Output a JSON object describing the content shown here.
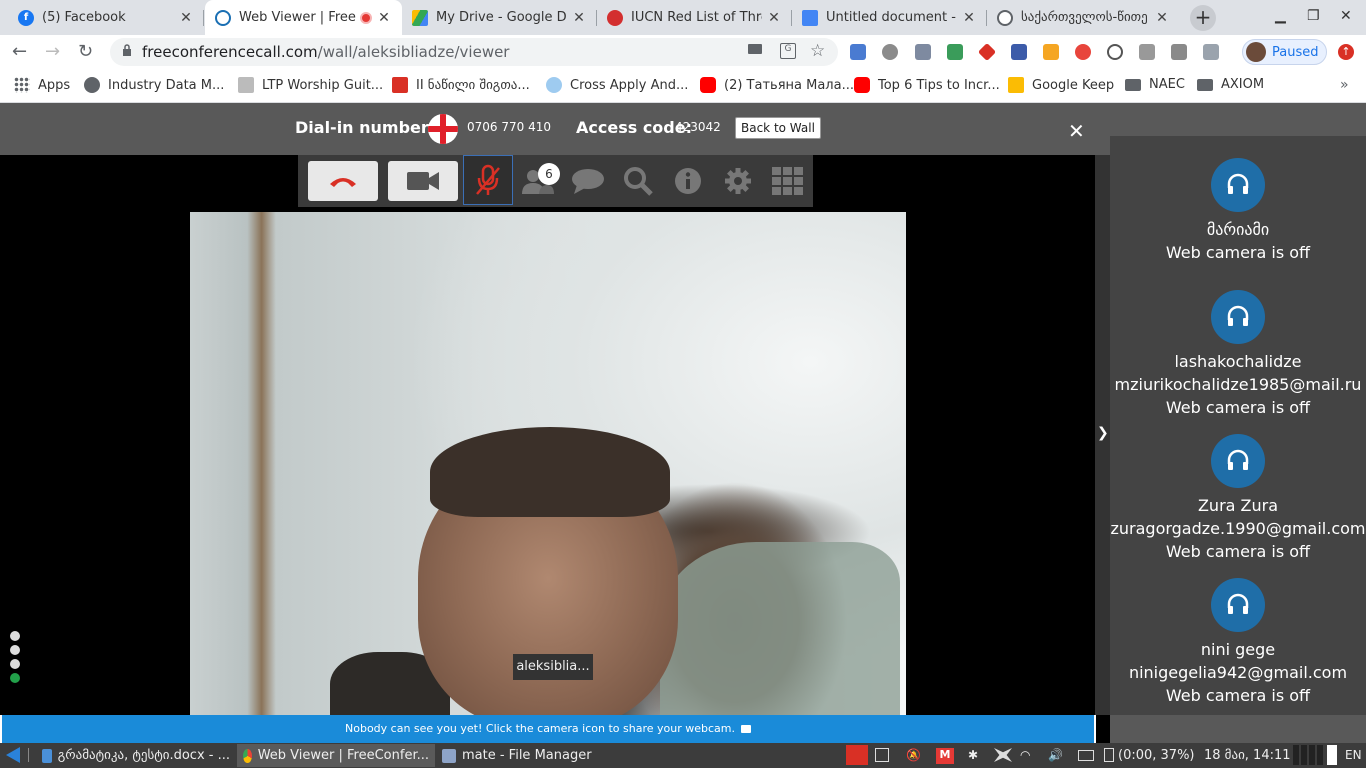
{
  "tabs": [
    {
      "label": "(5) Facebook",
      "favicon": "facebook-icon",
      "color": "#1877f2"
    },
    {
      "label": "Web Viewer | Free",
      "favicon": "viewer-icon",
      "color": "#1a6fb3",
      "active": true
    },
    {
      "label": "My Drive - Google Driv",
      "favicon": "google-drive-icon",
      "color": "#34a853"
    },
    {
      "label": "IUCN Red List of Threa",
      "favicon": "iucn-icon",
      "color": "#d32f2f"
    },
    {
      "label": "Untitled document - G",
      "favicon": "google-docs-icon",
      "color": "#4285f4"
    },
    {
      "label": "საქართველოს-წითე",
      "favicon": "globe-icon",
      "color": "#5f6368"
    }
  ],
  "address": {
    "domain": "freeconferencecall.com",
    "path": "/wall/aleksibliadze/viewer"
  },
  "profile": {
    "label": "Paused"
  },
  "bookmarks": [
    {
      "label": "Apps",
      "icon": "apps-grid-icon"
    },
    {
      "label": "Industry Data M...",
      "icon": "globe-icon"
    },
    {
      "label": "LTP Worship Guit...",
      "icon": "page-icon"
    },
    {
      "label": "II ნაწილი შიგთა...",
      "icon": "pdf-icon"
    },
    {
      "label": "Cross Apply And...",
      "icon": "sparkle-icon"
    },
    {
      "label": "(2) Татьяна Мала...",
      "icon": "youtube-icon"
    },
    {
      "label": "Top 6 Tips to Incr...",
      "icon": "youtube-icon"
    },
    {
      "label": "Google Keep",
      "icon": "keep-icon"
    },
    {
      "label": "NAEC",
      "icon": "folder-icon"
    },
    {
      "label": "AXIOM",
      "icon": "folder-icon"
    }
  ],
  "dialbar": {
    "dial_label": "Dial-in number:",
    "dial_number": "0706 770 410",
    "access_label": "Access code:",
    "access_code": "423042",
    "back_button": "Back to Wall"
  },
  "callbar": {
    "participants_count": "6"
  },
  "video": {
    "name_tag": "aleksiblia..."
  },
  "notice": "Nobody can see you yet! Click the camera icon to share your webcam.",
  "participants": [
    {
      "lines": [
        "მარიამი",
        "Web camera is off"
      ]
    },
    {
      "lines": [
        "lashakochalidze",
        "mziurikochalidze1985@mail.ru",
        "Web camera is off"
      ]
    },
    {
      "lines": [
        "Zura Zura",
        "zuragorgadze.1990@gmail.com",
        "Web camera is off"
      ]
    },
    {
      "lines": [
        "nini gege",
        "ninigegelia942@gmail.com",
        "Web camera is off"
      ]
    }
  ],
  "taskbar": {
    "tasks": [
      {
        "label": "გრამატიკა, ტესტი.docx - ...",
        "icon": "document-icon"
      },
      {
        "label": "Web Viewer | FreeConfer...",
        "icon": "chrome-icon"
      },
      {
        "label": "mate - File Manager",
        "icon": "folder-icon"
      }
    ],
    "battery": "(0:00, 37%)",
    "clock": "18 მაი, 14:11",
    "lang": "EN"
  }
}
